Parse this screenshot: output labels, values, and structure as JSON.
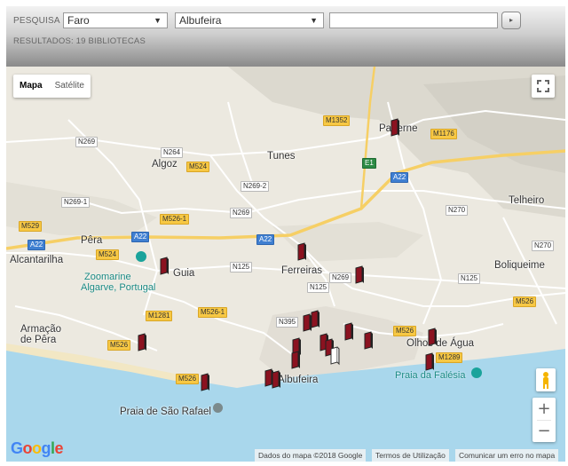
{
  "search": {
    "label": "PESQUISA",
    "district": "Faro",
    "municipality": "Albufeira",
    "text_value": "",
    "go_arrow": "▸",
    "dropdown_arrow": "▼",
    "results": "RESULTADOS: 19 BIBLIOTECAS"
  },
  "map": {
    "type_control": {
      "map": "Mapa",
      "satellite": "Satélite",
      "active": "Mapa"
    },
    "zoom_in": "+",
    "zoom_out": "−",
    "places": {
      "paderne": "Paderne",
      "tunes": "Tunes",
      "algoz": "Algoz",
      "telheiro": "Telheiro",
      "pera": "Pêra",
      "alcantarilha": "Alcantarilha",
      "boliqueime": "Boliqueime",
      "ferreiras": "Ferreiras",
      "armacao_1": "Armação",
      "armacao_2": "de Pêra",
      "olhos": "Olhos de Água",
      "albufeira": "Albufeira",
      "guia": "Guia",
      "sao_rafael": "Praia de São Rafael"
    },
    "pois": {
      "zoomarine_1": "Zoomarine",
      "zoomarine_2": "Algarve, Portugal",
      "falesia": "Praia da Falésia"
    },
    "roads": {
      "n269a": "N269",
      "n264": "N264",
      "m524a": "M524",
      "n2692": "N269-2",
      "n269b": "N269",
      "n2691": "N269-1",
      "m529": "M529",
      "a22a": "A22",
      "a22b": "A22",
      "a22c": "A22",
      "a22d": "A22",
      "m524b": "M524",
      "m5261a": "M526-1",
      "m1352": "M1352",
      "m1176": "M1176",
      "e1": "E1",
      "n270a": "N270",
      "n270b": "N270",
      "n125a": "N125",
      "n125b": "N125",
      "n125c": "N125",
      "n269c": "N269",
      "n395": "N395",
      "m1281": "M1281",
      "m5261b": "M526-1",
      "m526a": "M526",
      "m526b": "M526",
      "m526c": "M526",
      "m526d": "M526",
      "m1289": "M1289"
    },
    "attribution": {
      "data": "Dados do mapa ©2018 Google",
      "terms": "Termos de Utilização",
      "report": "Comunicar um erro no mapa"
    },
    "logo": "Google",
    "colors": {
      "water": "#a9d7ec",
      "land": "#ece9e0",
      "road": "#ffffff",
      "highway": "#f6cf65",
      "marker": "#8b1220",
      "panel_top": "#f2f2f2",
      "panel_bottom": "#8a8a8a"
    },
    "library_markers": 19
  }
}
